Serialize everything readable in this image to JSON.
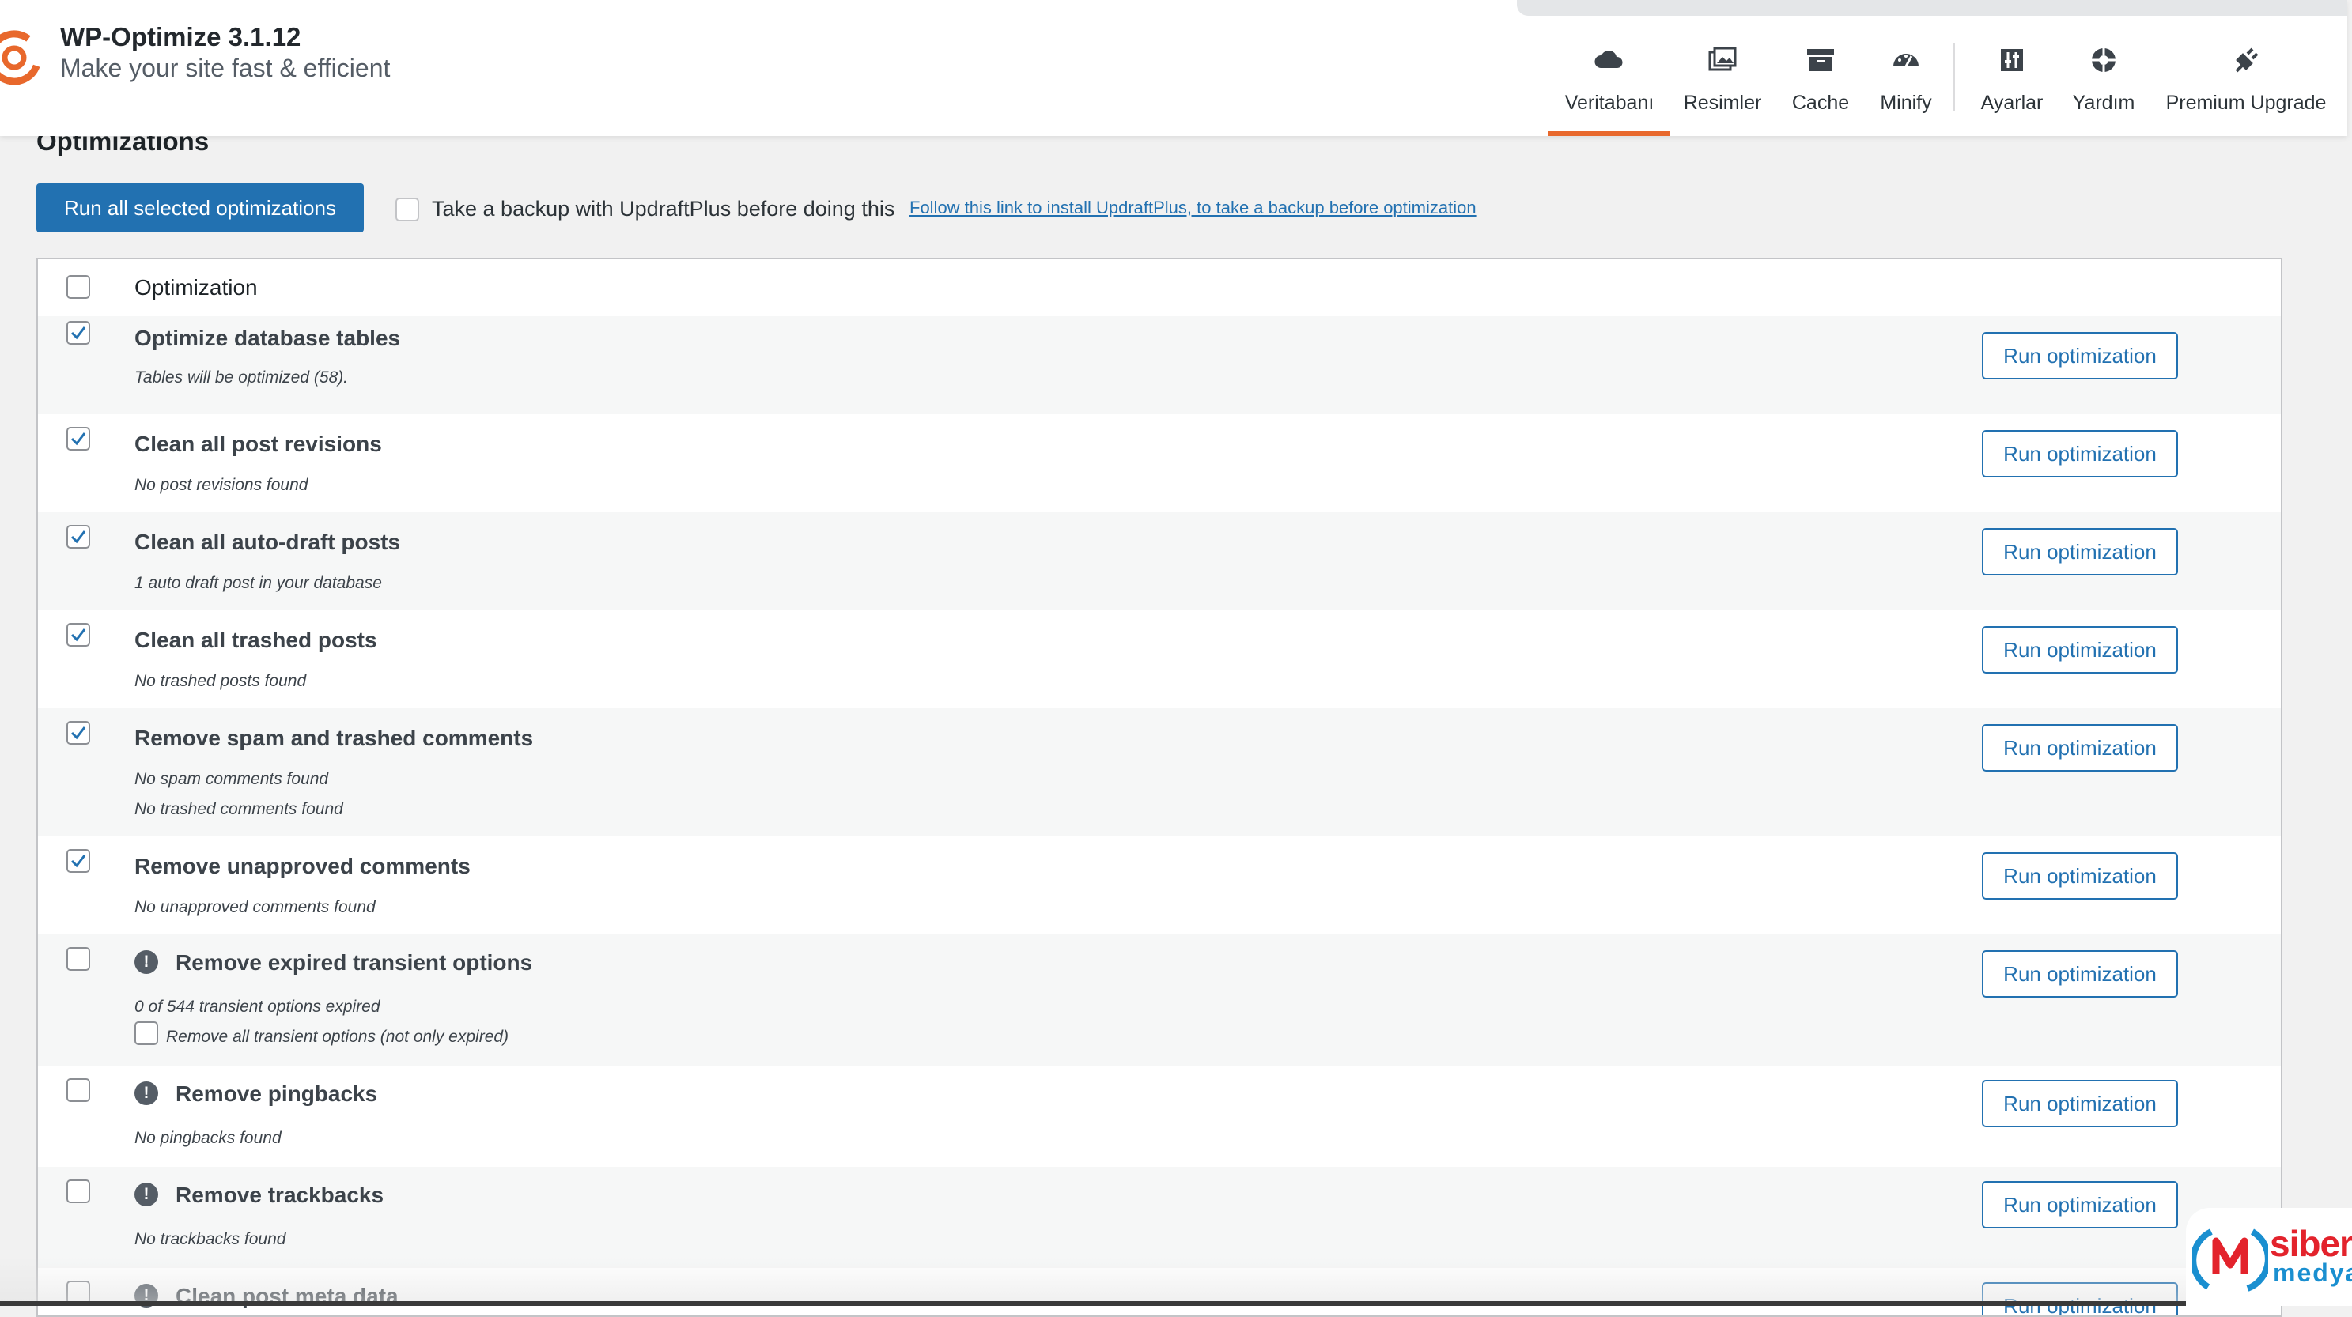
{
  "app": {
    "title": "WP-Optimize 3.1.12",
    "subtitle": "Make your site fast & efficient"
  },
  "nav": {
    "tabs": [
      {
        "label": "Veritabanı",
        "icon": "cloud-icon",
        "active": true
      },
      {
        "label": "Resimler",
        "icon": "images-icon"
      },
      {
        "label": "Cache",
        "icon": "archive-icon"
      },
      {
        "label": "Minify",
        "icon": "dashboard-gauge-icon"
      },
      {
        "label": "Ayarlar",
        "icon": "settings-sliders-icon"
      },
      {
        "label": "Yardım",
        "icon": "sos-lifebuoy-icon"
      },
      {
        "label": "Premium Upgrade",
        "icon": "plugin-icon"
      }
    ]
  },
  "section": {
    "title": "Optimizations",
    "run_all_label": "Run all selected optimizations",
    "backup_text": "Take a backup with UpdraftPlus before doing this",
    "backup_link": "Follow this link to install UpdraftPlus, to take a backup before optimization"
  },
  "table": {
    "header_label": "Optimization",
    "run_button_label": "Run optimization",
    "rows": [
      {
        "title": "Optimize database tables",
        "notes": [
          "Tables will be optimized (58)."
        ],
        "checked": true,
        "warning": false
      },
      {
        "title": "Clean all post revisions",
        "notes": [
          "No post revisions found"
        ],
        "checked": true,
        "warning": false
      },
      {
        "title": "Clean all auto-draft posts",
        "notes": [
          "1 auto draft post in your database"
        ],
        "checked": true,
        "warning": false
      },
      {
        "title": "Clean all trashed posts",
        "notes": [
          "No trashed posts found"
        ],
        "checked": true,
        "warning": false
      },
      {
        "title": "Remove spam and trashed comments",
        "notes": [
          "No spam comments found",
          "No trashed comments found"
        ],
        "checked": true,
        "warning": false
      },
      {
        "title": "Remove unapproved comments",
        "notes": [
          "No unapproved comments found"
        ],
        "checked": true,
        "warning": false
      },
      {
        "title": "Remove expired transient options",
        "notes": [
          "0 of 544 transient options expired"
        ],
        "sub_option": "Remove all transient options (not only expired)",
        "checked": false,
        "warning": true
      },
      {
        "title": "Remove pingbacks",
        "notes": [
          "No pingbacks found"
        ],
        "checked": false,
        "warning": true
      },
      {
        "title": "Remove trackbacks",
        "notes": [
          "No trackbacks found"
        ],
        "checked": false,
        "warning": true
      },
      {
        "title": "Clean post meta data",
        "notes": [],
        "checked": false,
        "warning": true
      }
    ]
  },
  "watermark": {
    "line1": "siber",
    "line2": "medya"
  },
  "colors": {
    "accent": "#2271b1",
    "active_tab": "#e8682c",
    "brand_red": "#e3232c",
    "brand_blue": "#1a8fd0"
  }
}
